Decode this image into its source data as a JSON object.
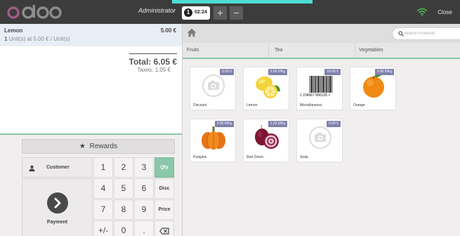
{
  "header": {
    "brand": "odoo",
    "user": "Administrator",
    "order_number": "1",
    "order_time": "02:24",
    "add_order_symbol": "+",
    "remove_order_symbol": "−",
    "close_label": "Close",
    "colors": {
      "topbar": "#3c3c3c",
      "accent_strip": "#4cdcd4",
      "wifi": "#4caf50"
    }
  },
  "order": {
    "line": {
      "product": "Lemon",
      "price": "5.00 €",
      "quantity": "1",
      "unit_info": "Unit(s) at 5.00 € / Unit(s)"
    },
    "total": "Total: 6.05 €",
    "taxes": "Taxes: 1.05 €"
  },
  "actionpad": {
    "rewards_label": "Rewards",
    "customer_label": "Customer",
    "payment_label": "Payment",
    "keys": [
      "1",
      "2",
      "3",
      "4",
      "5",
      "6",
      "7",
      "8",
      "9",
      "+/-",
      "0",
      "."
    ],
    "modes": {
      "qty": "Qty",
      "disc": "Disc",
      "price": "Price"
    },
    "active_mode": "Qty",
    "accent_color": "#8bc7a9"
  },
  "products_screen": {
    "search_placeholder": "Search Products",
    "categories": [
      "Fruits",
      "Tea",
      "Vegetables"
    ],
    "products": [
      {
        "name": "Discount",
        "price": "0.00 €",
        "image": "camera-placeholder-icon"
      },
      {
        "name": "Lemon",
        "price": "3.00 €/Kg",
        "image": "lemon-image"
      },
      {
        "name": "Miscellaneous",
        "price": "18.00 €",
        "image": "barcode-image",
        "barcode_text": "1 234567 890128 >"
      },
      {
        "name": "Orange",
        "price": "3.00 €/Kg",
        "image": "orange-image"
      },
      {
        "name": "Pumpkin",
        "price": "3.00 €/Kg",
        "image": "pumpkin-image"
      },
      {
        "name": "Red Onion",
        "price": "1.23 €/Kg",
        "image": "red-onion-image"
      },
      {
        "name": "Soda",
        "price": "0.00 €",
        "image": "camera-placeholder-icon"
      }
    ],
    "price_tag_color": "#7f82ac"
  }
}
